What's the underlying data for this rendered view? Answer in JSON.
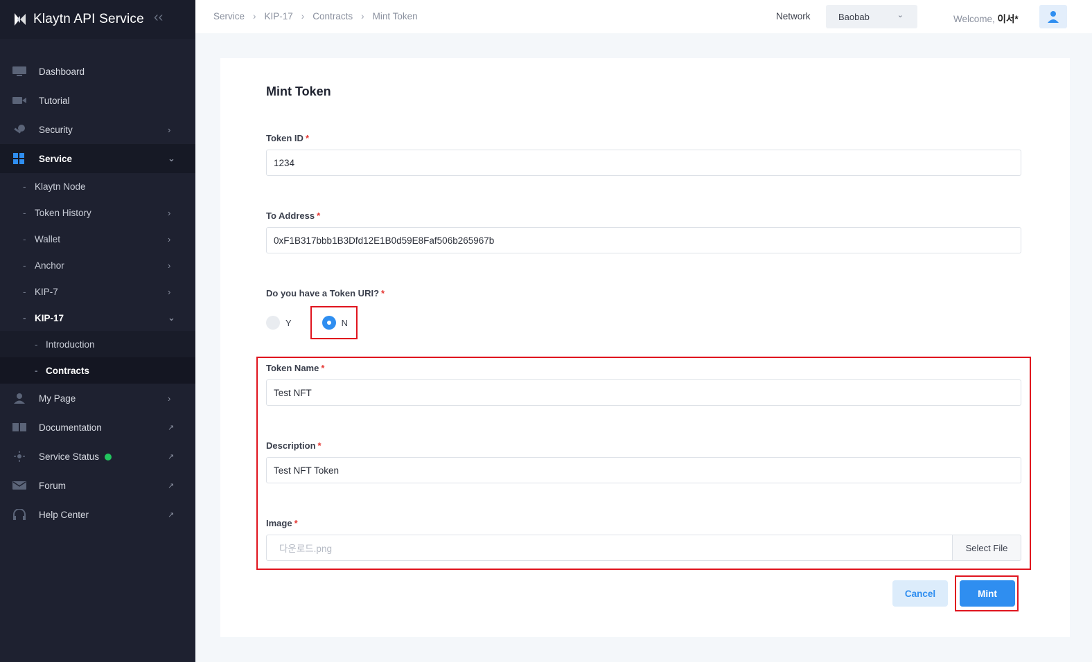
{
  "brand": {
    "name": "Klaytn API Service"
  },
  "sidebar": {
    "items": [
      {
        "label": "Dashboard",
        "icon": "monitor-icon"
      },
      {
        "label": "Tutorial",
        "icon": "video-camera-icon"
      },
      {
        "label": "Security",
        "icon": "key-icon"
      },
      {
        "label": "Service",
        "icon": "grid-icon"
      }
    ],
    "service_sub": [
      {
        "label": "Klaytn Node"
      },
      {
        "label": "Token History"
      },
      {
        "label": "Wallet"
      },
      {
        "label": "Anchor"
      },
      {
        "label": "KIP-7"
      },
      {
        "label": "KIP-17"
      }
    ],
    "kip17_sub": [
      {
        "label": "Introduction"
      },
      {
        "label": "Contracts"
      }
    ],
    "bottom_items": [
      {
        "label": "My Page",
        "icon": "user-icon"
      },
      {
        "label": "Documentation",
        "icon": "book-icon"
      },
      {
        "label": "Service Status",
        "icon": "sun-icon"
      },
      {
        "label": "Forum",
        "icon": "mail-icon"
      },
      {
        "label": "Help Center",
        "icon": "headphones-icon"
      }
    ]
  },
  "breadcrumb": [
    "Service",
    "KIP-17",
    "Contracts",
    "Mint Token"
  ],
  "network": {
    "label": "Network",
    "value": "Baobab"
  },
  "welcome": {
    "prefix": "Welcome,",
    "name": "이서*"
  },
  "form": {
    "title": "Mint Token",
    "token_id": {
      "label": "Token ID",
      "value": "1234"
    },
    "to_address": {
      "label": "To Address",
      "value": "0xF1B317bbb1B3Dfd12E1B0d59E8Faf506b265967b"
    },
    "token_uri": {
      "label": "Do you have a Token URI?",
      "options": [
        "Y",
        "N"
      ],
      "selected": "N"
    },
    "token_name": {
      "label": "Token Name",
      "value": "Test NFT"
    },
    "description": {
      "label": "Description",
      "value": "Test NFT Token"
    },
    "image": {
      "label": "Image",
      "placeholder": "다운로드.png",
      "button": "Select File"
    },
    "required_mark": "*",
    "cancel_label": "Cancel",
    "mint_label": "Mint"
  },
  "colors": {
    "accent": "#2f8ef0",
    "sidebar_bg": "#1e2130",
    "highlight": "#e0141e",
    "status_ok": "#22c55e"
  }
}
